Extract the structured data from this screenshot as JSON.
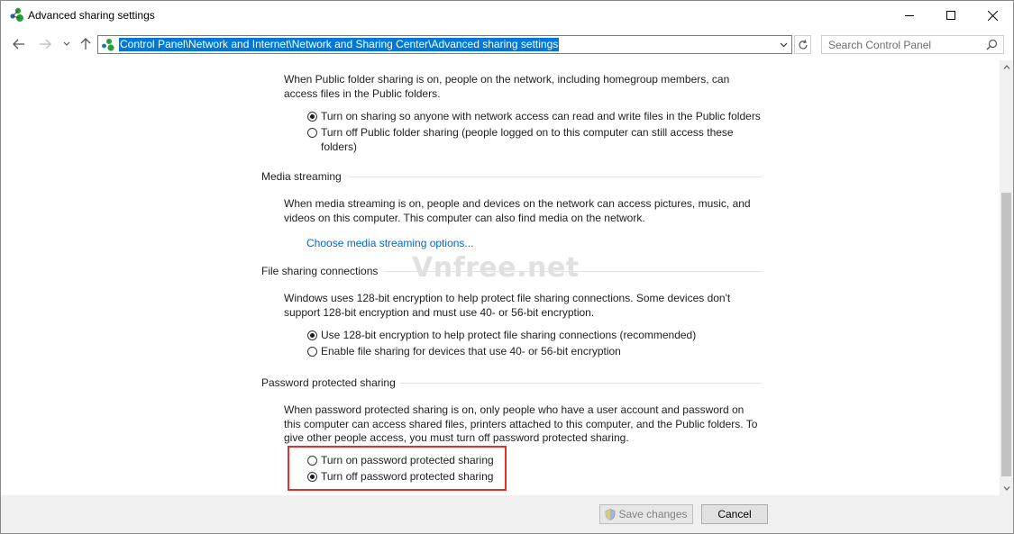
{
  "window": {
    "title": "Advanced sharing settings"
  },
  "nav": {
    "back_icon": "back-arrow-icon",
    "forward_icon": "forward-arrow-icon",
    "recent_icon": "chevron-down-icon",
    "up_icon": "up-arrow-icon"
  },
  "address": {
    "path": "Control Panel\\Network and Internet\\Network and Sharing Center\\Advanced sharing settings"
  },
  "search": {
    "placeholder": "Search Control Panel"
  },
  "public_folder": {
    "description": "When Public folder sharing is on, people on the network, including homegroup members, can access files in the Public folders.",
    "options": [
      {
        "label": "Turn on sharing so anyone with network access can read and write files in the Public folders",
        "checked": true
      },
      {
        "label": "Turn off Public folder sharing (people logged on to this computer can still access these folders)",
        "checked": false
      }
    ]
  },
  "media_streaming": {
    "title": "Media streaming",
    "description": "When media streaming is on, people and devices on the network can access pictures, music, and videos on this computer. This computer can also find media on the network.",
    "link": "Choose media streaming options..."
  },
  "file_sharing": {
    "title": "File sharing connections",
    "description": "Windows uses 128-bit encryption to help protect file sharing connections. Some devices don't support 128-bit encryption and must use 40- or 56-bit encryption.",
    "options": [
      {
        "label": "Use 128-bit encryption to help protect file sharing connections (recommended)",
        "checked": true
      },
      {
        "label": "Enable file sharing for devices that use 40- or 56-bit encryption",
        "checked": false
      }
    ]
  },
  "password_sharing": {
    "title": "Password protected sharing",
    "description": "When password protected sharing is on, only people who have a user account and password on this computer can access shared files, printers attached to this computer, and the Public folders. To give other people access, you must turn off password protected sharing.",
    "options": [
      {
        "label": "Turn on password protected sharing",
        "checked": false
      },
      {
        "label": "Turn off password protected sharing",
        "checked": true
      }
    ]
  },
  "watermark": "Vnfree.net",
  "footer": {
    "save_label": "Save changes",
    "cancel_label": "Cancel"
  },
  "colors": {
    "selection": "#0078d7",
    "link": "#0066cc",
    "highlight_box": "#e0312b"
  }
}
